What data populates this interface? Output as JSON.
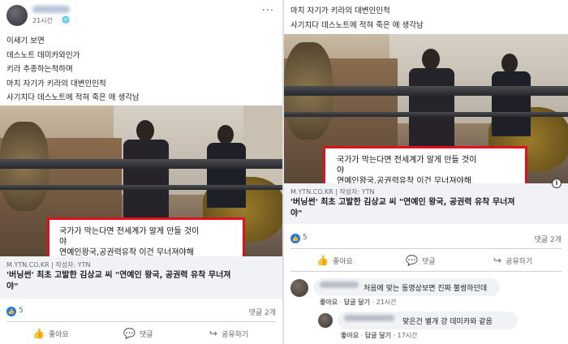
{
  "left_post": {
    "timestamp": "21시간",
    "more_label": "···",
    "lines": [
      "이새기 보면",
      "데스노트 데미카와인가",
      "키라 추종하는척하며",
      "마치 자기가 키라의 대변인인척",
      "사기치다 데스노트에 적혀 죽은 애 생각남"
    ],
    "image_caption": [
      "국가가 막는다면 전세계가 알게 만들 것이",
      "야",
      "연예인왕국,공권력유착 이건 무너져야해"
    ],
    "link_domain": "M.YTN.CO.KR | 작성자: YTN",
    "link_title": [
      "'버닝썬' 최초 고발한 김상교 씨 \"연예인 왕국, 공권력 유착 무너져",
      "야\""
    ],
    "reaction_count": "5",
    "comment_count": "댓글 2개",
    "actions": [
      "좋아요",
      "댓글",
      "공유하기"
    ]
  },
  "right_post": {
    "lines": [
      "마치 자기가 키라의 대변인인척",
      "사기치다 데스노트에 적혀 죽은 애 생각남"
    ],
    "image_caption": [
      "국가가 막는다면 전세계가 알게 만들 것이",
      "야",
      "연예인왕국,공권력유착 이건 무너져야해"
    ],
    "link_domain": "M.YTN.CO.KR | 작성자: YTN",
    "link_title": [
      "'버닝썬' 최초 고발한 김상교 씨 \"연예인 왕국, 공권력 유착 무너져",
      "야\""
    ],
    "reaction_count": "5",
    "comment_count": "댓글 2개",
    "actions": [
      "좋아요",
      "댓글",
      "공유하기"
    ],
    "comments": [
      {
        "text": "처음에 맞는 동영상보면 진짜 불쌍하던데",
        "like": "좋아요",
        "reply": "답글 달기",
        "time": "21시간"
      },
      {
        "text": "맞은건 별개 걍 데미카와 같음",
        "like": "좋아요",
        "reply": "답글 달기",
        "time": "17시간"
      }
    ]
  },
  "icons": {
    "globe": "globe-icon",
    "info": "info-icon",
    "like": "thumbs-up-icon",
    "comment": "comment-icon",
    "share": "share-icon"
  },
  "colors": {
    "caption_border": "#e1101c",
    "like_blue": "#1877f2",
    "card_bg": "#f0f2f5"
  }
}
